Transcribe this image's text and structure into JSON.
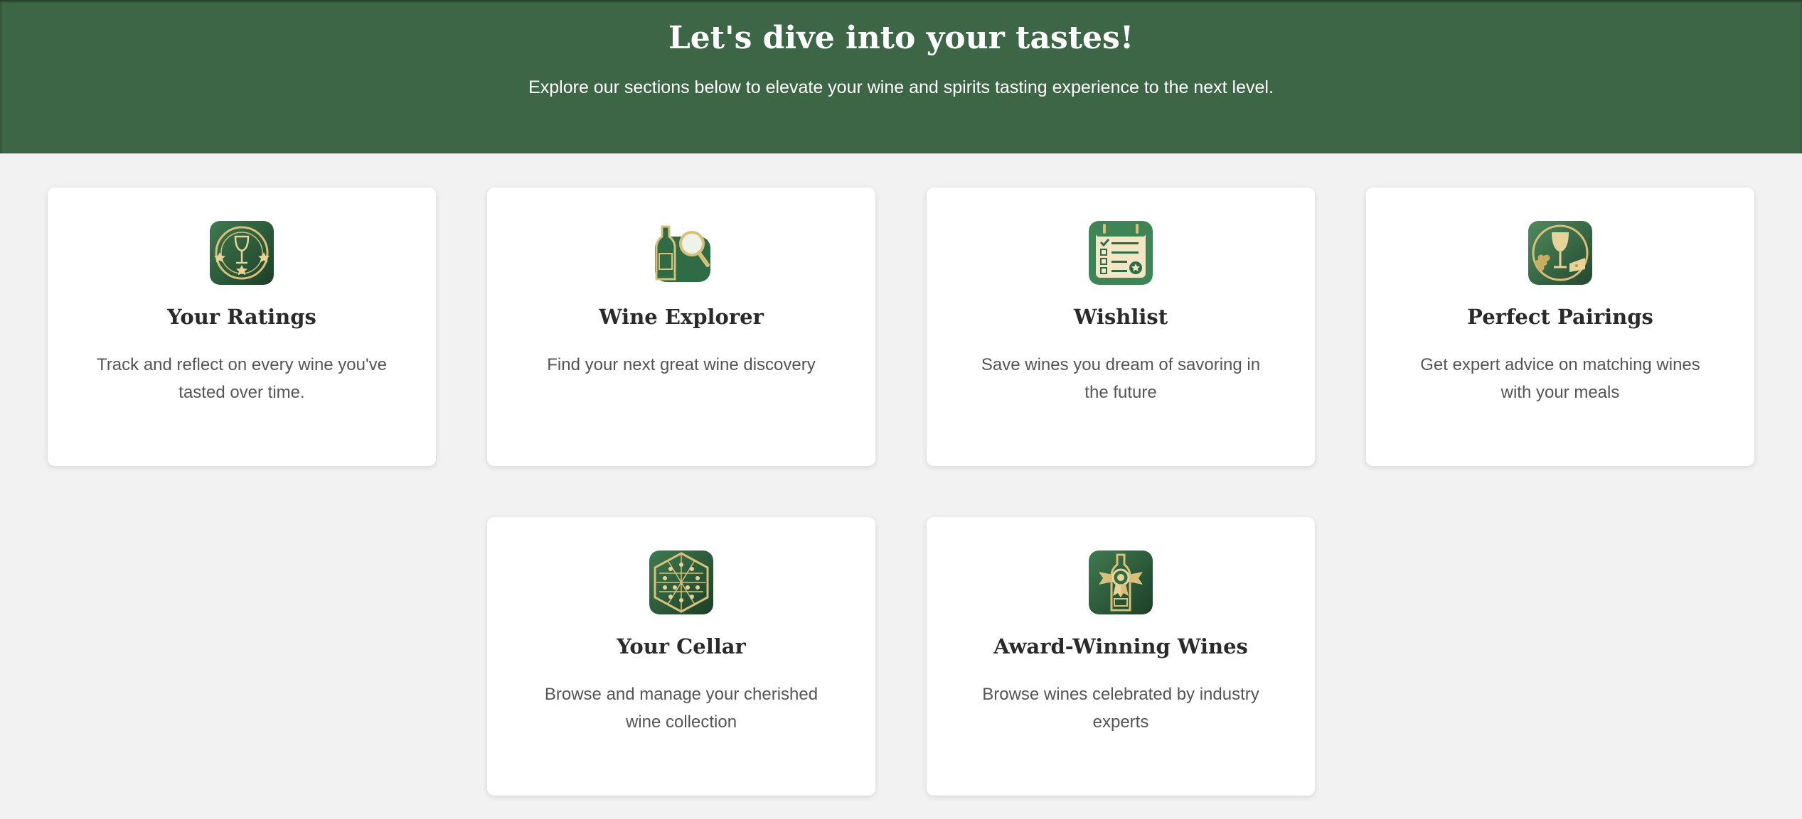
{
  "hero": {
    "title": "Let's dive into your tastes!",
    "subtitle": "Explore our sections below to elevate your wine and spirits tasting experience to the next level."
  },
  "colors": {
    "hero_background": "#3c6645",
    "page_background": "#f2f2f2",
    "icon_green": "#2f6b45",
    "icon_gold": "#d8bf7a"
  },
  "cards": [
    {
      "title": "Your Ratings",
      "description": "Track and reflect on every wine you've tasted over time.",
      "icon": "ratings-stars-glass-icon"
    },
    {
      "title": "Wine Explorer",
      "description": "Find your next great wine discovery",
      "icon": "wine-bottle-magnifier-icon"
    },
    {
      "title": "Wishlist",
      "description": "Save wines you dream of savoring in the future",
      "icon": "checklist-calendar-icon"
    },
    {
      "title": "Perfect Pairings",
      "description": "Get expert advice on matching wines with your meals",
      "icon": "wine-glass-grapes-cheese-icon"
    },
    {
      "title": "Your Cellar",
      "description": "Browse and manage your cherished wine collection",
      "icon": "hexagon-wine-rack-icon"
    },
    {
      "title": "Award-Winning Wines",
      "description": "Browse wines celebrated by industry experts",
      "icon": "bottle-award-ribbon-icon"
    }
  ]
}
